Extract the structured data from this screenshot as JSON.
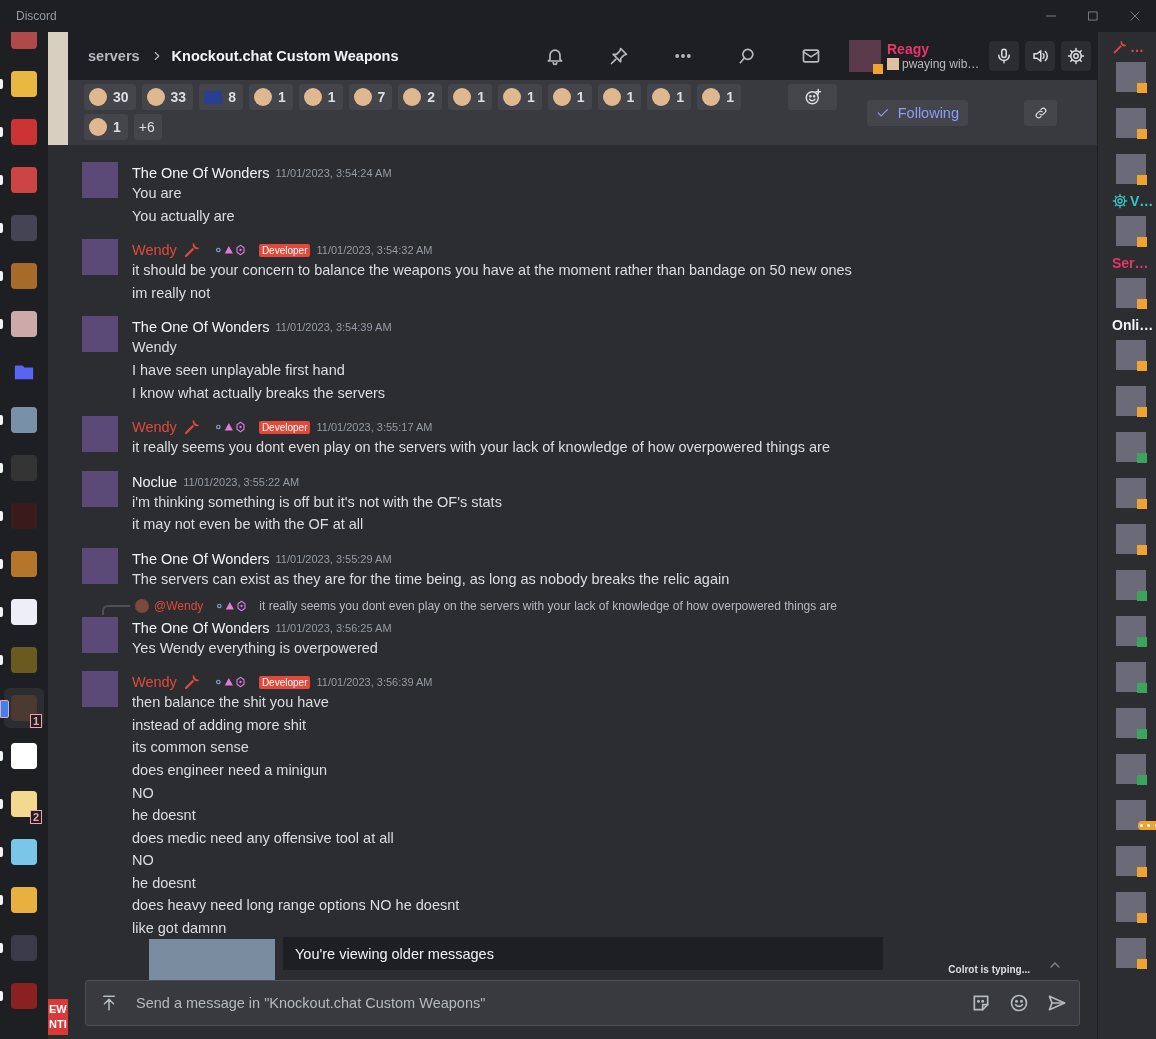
{
  "window": {
    "title": "Discord"
  },
  "servers": [
    {
      "unread": false,
      "selected": false
    },
    {
      "unread": true,
      "selected": false
    },
    {
      "unread": true,
      "selected": false
    },
    {
      "unread": true,
      "selected": false
    },
    {
      "unread": true,
      "selected": false
    },
    {
      "unread": true,
      "selected": false
    },
    {
      "unread": true,
      "selected": false
    },
    {
      "unread": false,
      "selected": false,
      "kind": "folder"
    },
    {
      "unread": true,
      "selected": false
    },
    {
      "unread": true,
      "selected": false
    },
    {
      "unread": true,
      "selected": false
    },
    {
      "unread": true,
      "selected": false
    },
    {
      "unread": true,
      "selected": false
    },
    {
      "unread": true,
      "selected": false
    },
    {
      "unread": false,
      "selected": true,
      "badge": "1"
    },
    {
      "unread": true,
      "selected": false
    },
    {
      "unread": true,
      "selected": false,
      "badge": "2"
    },
    {
      "unread": true,
      "selected": false
    },
    {
      "unread": true,
      "selected": false
    },
    {
      "unread": true,
      "selected": false
    },
    {
      "unread": true,
      "selected": false
    }
  ],
  "channel_fragment": [
    "EW",
    "NTI"
  ],
  "header": {
    "breadcrumb": "servers",
    "title": "Knockout.chat Custom Weapons",
    "user": {
      "name": "Reagy",
      "status": "pwaying wib…"
    }
  },
  "reactions": [
    {
      "kind": "emoji",
      "count": "30"
    },
    {
      "kind": "emoji",
      "count": "33"
    },
    {
      "kind": "flag",
      "count": "8"
    },
    {
      "kind": "emoji",
      "count": "1"
    },
    {
      "kind": "emoji",
      "count": "1"
    },
    {
      "kind": "emoji",
      "count": "7"
    },
    {
      "kind": "emoji",
      "count": "2"
    },
    {
      "kind": "emoji",
      "count": "1"
    },
    {
      "kind": "emoji",
      "count": "1"
    },
    {
      "kind": "emoji",
      "count": "1"
    },
    {
      "kind": "emoji",
      "count": "1"
    },
    {
      "kind": "emoji",
      "count": "1"
    },
    {
      "kind": "emoji",
      "count": "1"
    },
    {
      "kind": "emoji",
      "count": "1"
    }
  ],
  "more_reactions": "+6",
  "follow_button": {
    "label": "Following",
    "following": true
  },
  "messages": [
    {
      "author": "The One Of Wonders",
      "color": "#f2f3f5",
      "role_icon": false,
      "badges": false,
      "time": "11/01/2023, 3:54:24 AM",
      "lines": [
        "You are",
        "You actually are"
      ]
    },
    {
      "author": "Wendy",
      "color": "#e2493b",
      "role_icon": true,
      "badges": true,
      "tag": "Developer",
      "time": "11/01/2023, 3:54:32 AM",
      "lines": [
        "it should be your concern to balance the weapons you have at the moment rather than bandage on 50 new ones",
        "im really not"
      ]
    },
    {
      "author": "The One Of Wonders",
      "color": "#f2f3f5",
      "role_icon": false,
      "badges": false,
      "time": "11/01/2023, 3:54:39 AM",
      "lines": [
        "Wendy",
        "I have seen unplayable first hand",
        "I know what actually breaks the servers"
      ]
    },
    {
      "author": "Wendy",
      "color": "#e2493b",
      "role_icon": true,
      "badges": true,
      "tag": "Developer",
      "time": "11/01/2023, 3:55:17 AM",
      "lines": [
        "it really seems you dont even play on the servers with your lack of knowledge of how overpowered things are"
      ]
    },
    {
      "author": "Noclue",
      "color": "#f2f3f5",
      "role_icon": false,
      "badges": false,
      "time": "11/01/2023, 3:55:22 AM",
      "lines": [
        "i'm thinking something is off but it's not with the OF's stats",
        "it may not even be with the OF at all"
      ]
    },
    {
      "author": "The One Of Wonders",
      "color": "#f2f3f5",
      "role_icon": false,
      "badges": false,
      "time": "11/01/2023, 3:55:29 AM",
      "lines": [
        "The servers can exist as they are for the time being, as long as nobody breaks the relic again"
      ]
    },
    {
      "author": "The One Of Wonders",
      "color": "#f2f3f5",
      "role_icon": false,
      "badges": false,
      "time": "11/01/2023, 3:56:25 AM",
      "reply": {
        "author": "@Wendy",
        "color": "#e2493b",
        "badges": true,
        "text": "it really seems you dont even play on the servers with your lack of knowledge of how overpowered things are"
      },
      "lines": [
        "Yes Wendy everything is overpowered"
      ]
    },
    {
      "author": "Wendy",
      "color": "#e2493b",
      "role_icon": true,
      "badges": true,
      "tag": "Developer",
      "time": "11/01/2023, 3:56:39 AM",
      "lines": [
        "then balance the shit you have",
        "instead of adding more shit",
        "its common sense",
        "does engineer need a minigun",
        "NO",
        "he doesnt",
        "does medic need any offensive tool at all",
        "NO",
        "he doesnt",
        "does heavy need long range options NO he doesnt",
        "like got damnn"
      ]
    }
  ],
  "toast": "You're viewing older messages",
  "typing": "Colrot is typing...",
  "composer": {
    "placeholder": "Send a message in \"Knockout.chat Custom Weapons\""
  },
  "members": [
    {
      "kind": "staff",
      "label": "…",
      "color": "#e2493b"
    },
    {
      "kind": "member",
      "color": "#f0a232"
    },
    {
      "kind": "member",
      "color": "#f0a232"
    },
    {
      "kind": "member",
      "color": "#f0a232"
    },
    {
      "kind": "bot",
      "label": "V…",
      "color": "#3ac4c4"
    },
    {
      "kind": "member",
      "color": "#f0a232"
    },
    {
      "kind": "role",
      "label": "Ser…",
      "color": "#e8356a"
    },
    {
      "kind": "member",
      "color": "#f0a232"
    },
    {
      "kind": "role",
      "label": "Onli…",
      "color": "#f2f3f5"
    },
    {
      "kind": "member",
      "color": "#f0a232"
    },
    {
      "kind": "member",
      "color": "#f0a232"
    },
    {
      "kind": "member",
      "color": "#3ba55d"
    },
    {
      "kind": "member",
      "color": "#f0a232"
    },
    {
      "kind": "member",
      "color": "#f0a232"
    },
    {
      "kind": "member",
      "color": "#3ba55d"
    },
    {
      "kind": "member",
      "color": "#3ba55d"
    },
    {
      "kind": "member",
      "color": "#3ba55d"
    },
    {
      "kind": "member",
      "color": "#3ba55d"
    },
    {
      "kind": "member",
      "color": "#3ba55d"
    },
    {
      "kind": "member",
      "color": "#f0a232",
      "typing": true
    },
    {
      "kind": "member",
      "color": "#f0a232"
    },
    {
      "kind": "member",
      "color": "#f0a232"
    },
    {
      "kind": "member",
      "color": "#f0a232"
    }
  ]
}
